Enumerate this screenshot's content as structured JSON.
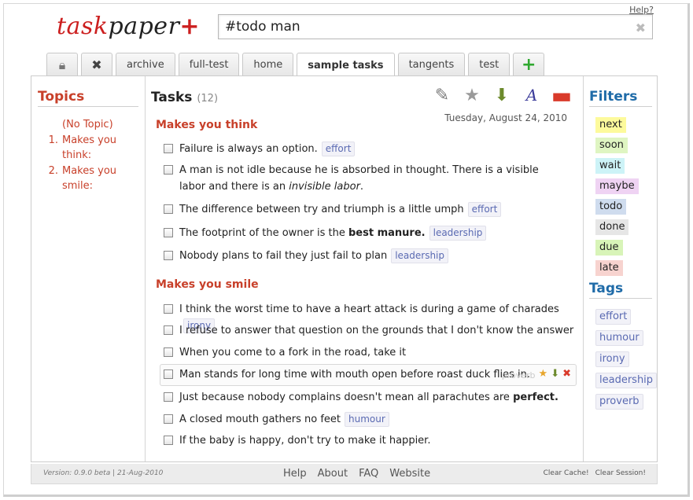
{
  "app": {
    "logo_part1": "task",
    "logo_part2": "paper",
    "logo_plus": "+",
    "help_link": "Help?"
  },
  "search": {
    "value": "#todo man",
    "clear_icon": "close-icon"
  },
  "tabs": [
    {
      "label": "",
      "icon": "lock-icon"
    },
    {
      "label": "",
      "icon": "close-icon"
    },
    {
      "label": "archive"
    },
    {
      "label": "full-test"
    },
    {
      "label": "home"
    },
    {
      "label": "sample tasks",
      "active": true
    },
    {
      "label": "tangents"
    },
    {
      "label": "test"
    },
    {
      "label": "+",
      "icon": "add-icon"
    }
  ],
  "topics": {
    "title": "Topics",
    "no_topic": "(No Topic)",
    "items": [
      {
        "num": "1.",
        "label": "Makes you think:"
      },
      {
        "num": "2.",
        "label": "Makes you smile:"
      }
    ]
  },
  "tasks_panel": {
    "title": "Tasks",
    "count": "(12)",
    "date": "Tuesday, August 24, 2010",
    "toolbar": [
      "edit-icon",
      "star-icon",
      "save-icon",
      "font-icon",
      "remove-icon"
    ]
  },
  "projects": [
    {
      "name": "Makes you think",
      "tasks": [
        {
          "text": "Failure is always an option.",
          "tag": "effort"
        },
        {
          "text_a": "A man is not idle because he is absorbed in thought. There is a visible labor and there is an",
          "text_em": "invisible labor",
          "text_b": "."
        },
        {
          "text": "The difference between try and triumph is a little umph",
          "tag": "effort"
        },
        {
          "text_a": "The footprint of the owner is the",
          "text_bold": "best manure.",
          "tag": "leadership"
        },
        {
          "text": "Nobody plans to fail they just fail to plan",
          "tag": "leadership"
        }
      ]
    },
    {
      "name": "Makes you smile",
      "tasks": [
        {
          "text": "I think the worst time to have a heart attack is during a game of charades",
          "tag": "irony"
        },
        {
          "text": "I refuse to answer that question on the grounds that I don't know the answer"
        },
        {
          "text": "When you come to a fork in the road, take it"
        },
        {
          "text": "Man stands for long time with mouth open before roast duck flies in.",
          "ghost_tag": "proverb"
        },
        {
          "text_a": "Just because nobody complains doesn't mean all parachutes are",
          "text_bold": "perfect."
        },
        {
          "text": "A closed mouth gathers no feet",
          "tag": "humour"
        },
        {
          "text": "If the baby is happy, don't try to make it happier."
        }
      ]
    }
  ],
  "filters": {
    "title": "Filters",
    "items": [
      {
        "label": "next",
        "color": "#fdfa9c"
      },
      {
        "label": "soon",
        "color": "#dff5c2"
      },
      {
        "label": "wait",
        "color": "#cdf3f7"
      },
      {
        "label": "maybe",
        "color": "#efd3f3"
      },
      {
        "label": "todo",
        "color": "#cfdcee"
      },
      {
        "label": "done",
        "color": "#e6e6e6"
      },
      {
        "label": "due",
        "color": "#d8f4b8"
      },
      {
        "label": "late",
        "color": "#f7d3cf"
      }
    ]
  },
  "tags": {
    "title": "Tags",
    "items": [
      "effort",
      "humour",
      "irony",
      "leadership",
      "proverb"
    ]
  },
  "footer": {
    "version": "Version: 0.9.0 beta | 21-Aug-2010",
    "links": [
      "Help",
      "About",
      "FAQ",
      "Website"
    ],
    "clear_cache": "Clear Cache!",
    "clear_session": "Clear Session!"
  }
}
